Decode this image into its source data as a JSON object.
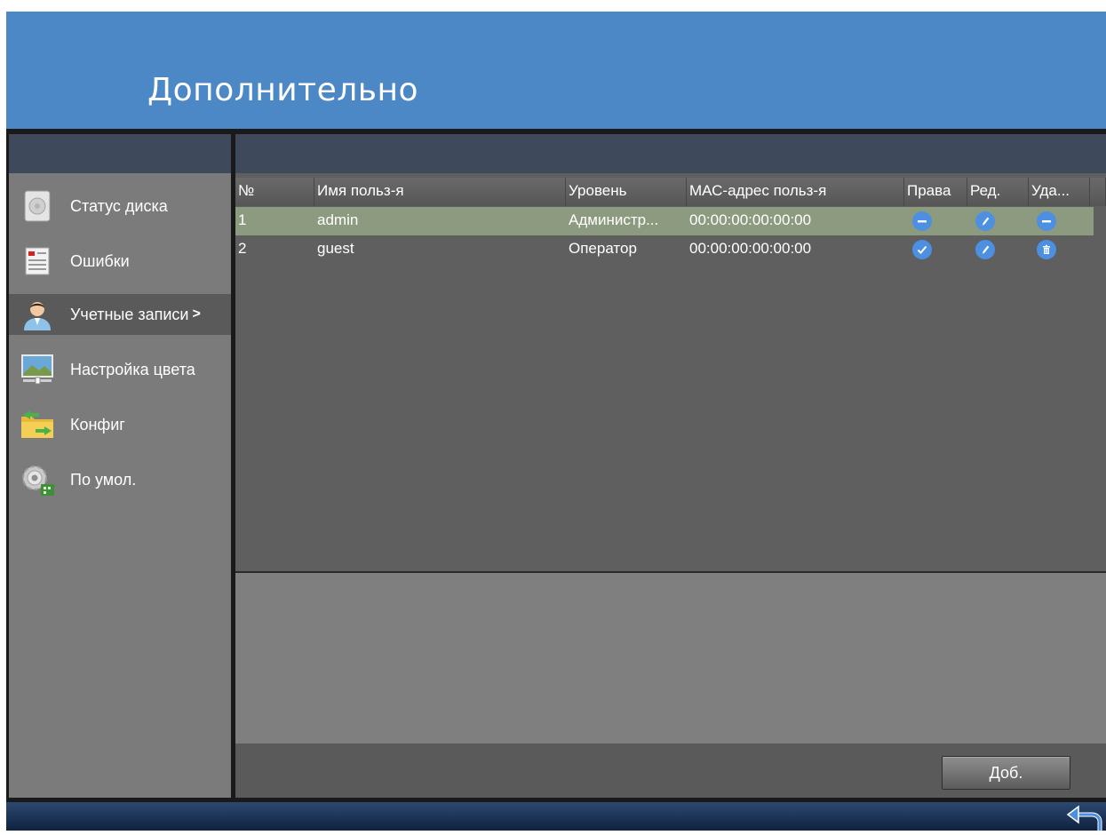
{
  "header": {
    "title": "Дополнительно"
  },
  "sidebar": {
    "items": [
      {
        "label": "Статус диска",
        "icon": "disk-icon"
      },
      {
        "label": "Ошибки",
        "icon": "log-icon"
      },
      {
        "label": "Учетные записи",
        "icon": "user-icon",
        "active": true,
        "arrow": ">"
      },
      {
        "label": "Настройка цвета",
        "icon": "image-color-icon"
      },
      {
        "label": "Конфиг",
        "icon": "folder-transfer-icon"
      },
      {
        "label": "По умол.",
        "icon": "gear-default-icon"
      }
    ]
  },
  "table": {
    "columns": [
      "№",
      "Имя польз-я",
      "Уровень",
      "МАС-адрес польз-я",
      "Права",
      "Ред.",
      "Уда..."
    ],
    "rows": [
      {
        "no": "1",
        "name": "admin",
        "level": "Администр...",
        "mac": "00:00:00:00:00:00",
        "rights_icon": "minus-icon",
        "edit_icon": "edit-icon",
        "delete_icon": "minus-icon"
      },
      {
        "no": "2",
        "name": "guest",
        "level": "Оператор",
        "mac": "00:00:00:00:00:00",
        "rights_icon": "check-icon",
        "edit_icon": "edit-icon",
        "delete_icon": "trash-icon"
      }
    ]
  },
  "footer": {
    "add_label": "Доб."
  },
  "colors": {
    "accent": "#4c87c6",
    "selected_row": "#8c9b7f",
    "icon_blue": "#4d8fe0"
  }
}
